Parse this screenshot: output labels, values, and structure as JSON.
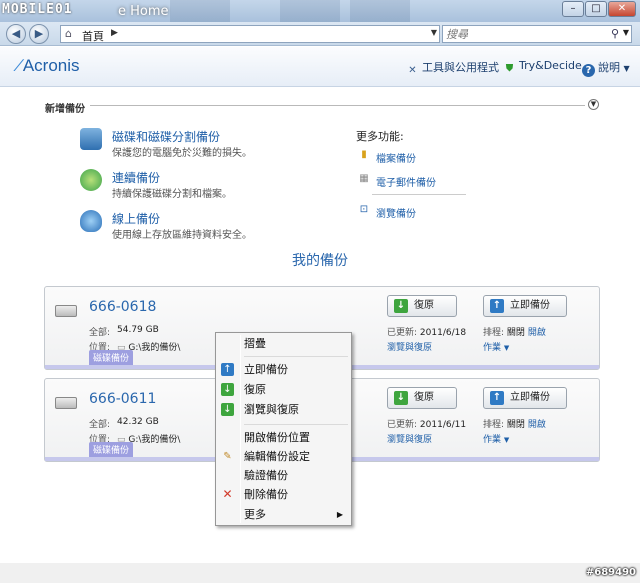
{
  "window": {
    "watermark": "MOBILE01",
    "title": "e Home",
    "controls": [
      "–",
      "□",
      "✕"
    ]
  },
  "nav": {
    "address": "首頁",
    "search_placeholder": "搜尋"
  },
  "header": {
    "logo": "Acronis",
    "links": [
      "工具與公用程式",
      "Try&Decide",
      "說明"
    ]
  },
  "new_backup": {
    "heading": "新增備份",
    "items": [
      {
        "title": "磁碟和磁碟分割備份",
        "desc": "保護您的電腦免於災難的損失。"
      },
      {
        "title": "連續備份",
        "desc": "持續保護磁碟分割和檔案。"
      },
      {
        "title": "線上備份",
        "desc": "使用線上存放區維持資料安全。"
      }
    ],
    "more_heading": "更多功能:",
    "more_items": [
      "檔案備份",
      "電子郵件備份",
      "瀏覽備份"
    ]
  },
  "my_backups": {
    "heading": "我的備份",
    "cards": [
      {
        "name": "666-0618",
        "total_label": "全部:",
        "total": "54.79 GB",
        "location_label": "位置:",
        "location": "G:\\我的備份\\",
        "tag": "磁碟備份",
        "restore_label": "復原",
        "backup_now_label": "立即備份",
        "updated_label": "已更新:",
        "updated": "2011/6/18",
        "browse_restore": "瀏覽與復原",
        "schedule_label": "排程:",
        "schedule_off": "關閉",
        "schedule_on": "開啟",
        "operations": "作業"
      },
      {
        "name": "666-0611",
        "total_label": "全部:",
        "total": "42.32 GB",
        "location_label": "位置:",
        "location": "G:\\我的備份\\",
        "tag": "磁碟備份",
        "restore_label": "復原",
        "backup_now_label": "立即備份",
        "updated_label": "已更新:",
        "updated": "2011/6/11",
        "browse_restore": "瀏覽與復原",
        "schedule_label": "排程:",
        "schedule_off": "關閉",
        "schedule_on": "開啟",
        "operations": "作業"
      }
    ]
  },
  "context_menu": {
    "items": [
      "摺疊",
      "立即備份",
      "復原",
      "瀏覽與復原",
      "開啟備份位置",
      "編輯備份設定",
      "驗證備份",
      "刪除備份",
      "更多"
    ]
  },
  "footer": {
    "watermark": "#689490"
  }
}
